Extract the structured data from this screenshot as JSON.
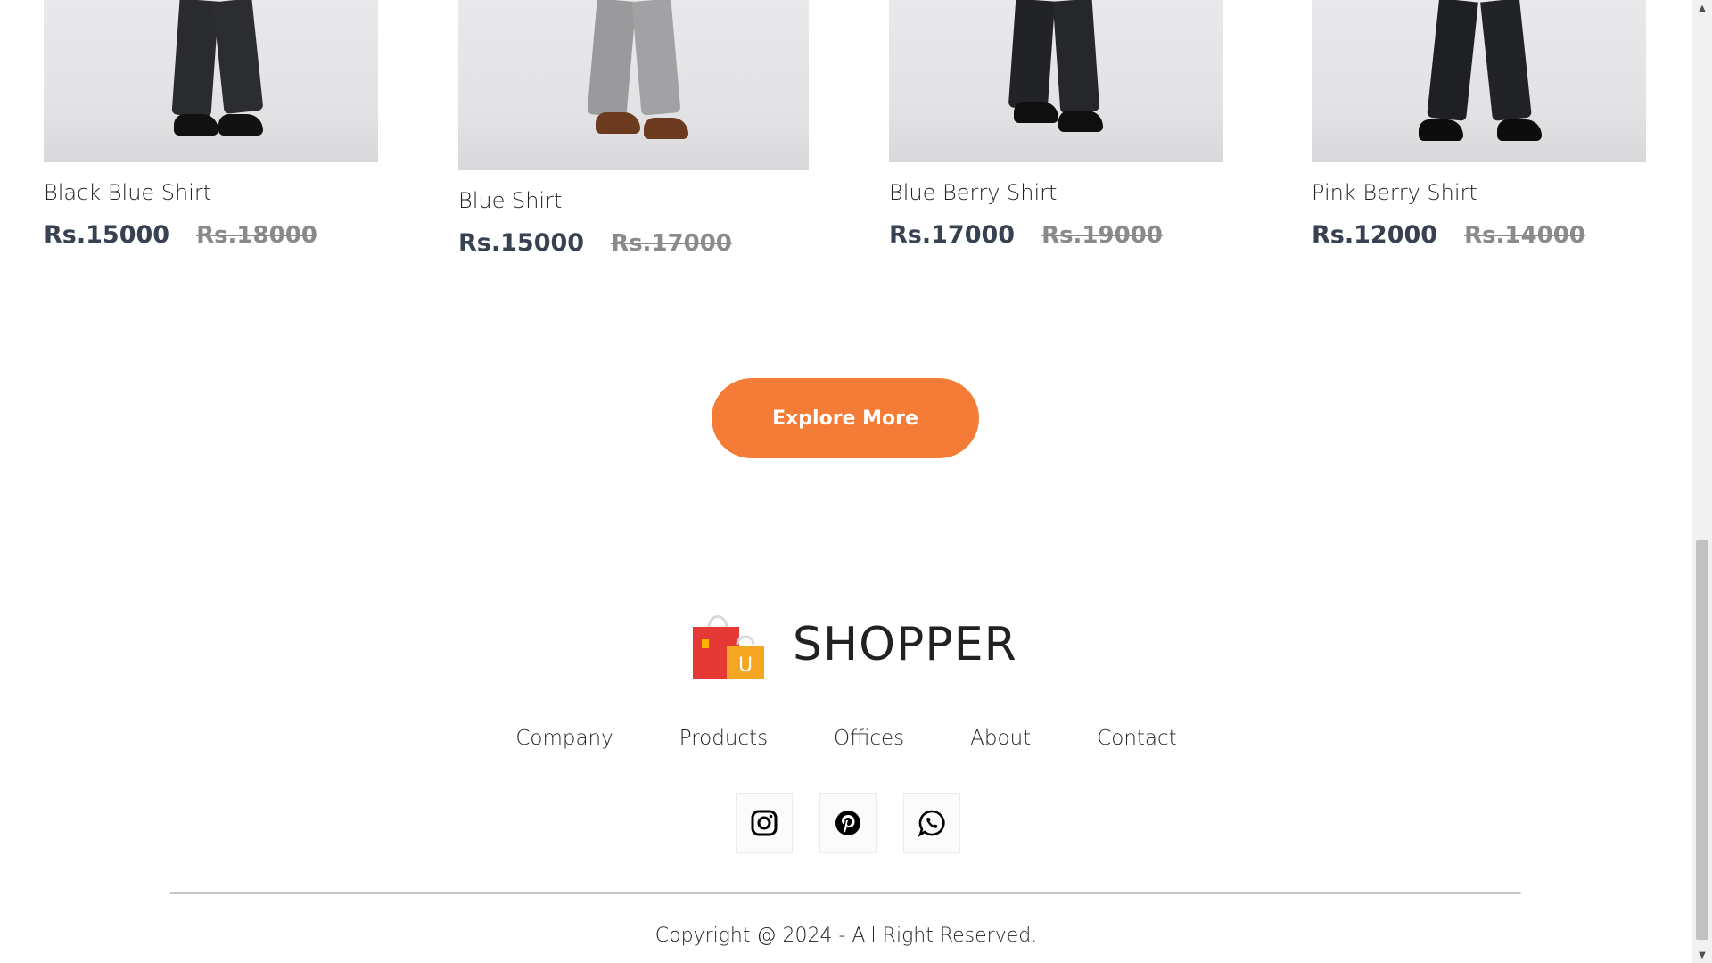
{
  "products": [
    {
      "name": "Black Blue Shirt",
      "new_price": "Rs.15000",
      "old_price": "Rs.18000"
    },
    {
      "name": "Blue Shirt",
      "new_price": "Rs.15000",
      "old_price": "Rs.17000"
    },
    {
      "name": "Blue Berry Shirt",
      "new_price": "Rs.17000",
      "old_price": "Rs.19000"
    },
    {
      "name": "Pink Berry Shirt",
      "new_price": "Rs.12000",
      "old_price": "Rs.14000"
    }
  ],
  "explore": {
    "label": "Explore More"
  },
  "footer": {
    "brand": "SHOPPER",
    "bag_letter": "U",
    "links": [
      "Company",
      "Products",
      "Offices",
      "About",
      "Contact"
    ],
    "socials": [
      "instagram-icon",
      "pinterest-icon",
      "whatsapp-icon"
    ],
    "copyright": "Copyright @ 2024 - All Right Reserved."
  },
  "colors": {
    "accent": "#f47c36",
    "price": "#374151",
    "old_price": "#8a8a8a"
  }
}
